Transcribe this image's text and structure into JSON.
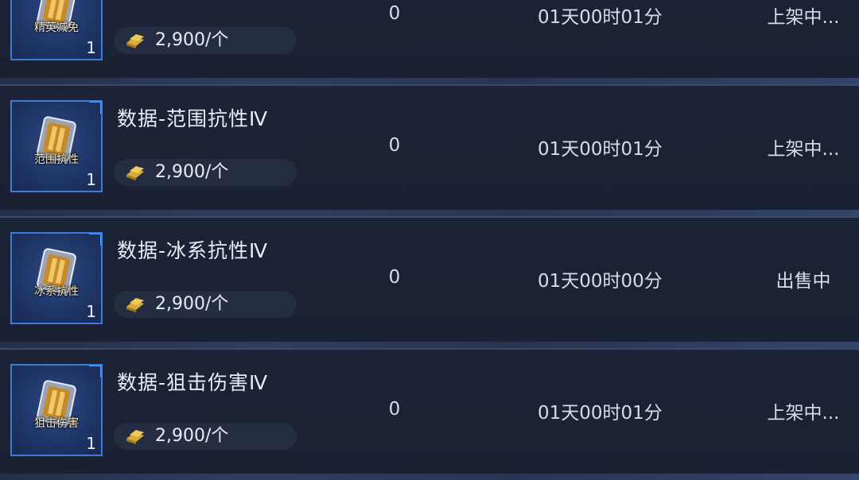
{
  "listings": [
    {
      "name": "",
      "item_label": "精英减免",
      "quantity": "1",
      "price": "2,900/个",
      "count": "0",
      "time_left": "01天00时01分",
      "status": "上架中..."
    },
    {
      "name": "数据-范围抗性Ⅳ",
      "item_label": "范围抗性",
      "quantity": "1",
      "price": "2,900/个",
      "count": "0",
      "time_left": "01天00时01分",
      "status": "上架中..."
    },
    {
      "name": "数据-冰系抗性Ⅳ",
      "item_label": "冰系抗性",
      "quantity": "1",
      "price": "2,900/个",
      "count": "0",
      "time_left": "01天00时00分",
      "status": "出售中"
    },
    {
      "name": "数据-狙击伤害Ⅳ",
      "item_label": "狙击伤害",
      "quantity": "1",
      "price": "2,900/个",
      "count": "0",
      "time_left": "01天00时01分",
      "status": "上架中..."
    }
  ],
  "icons": {
    "item": "data-chip-icon",
    "currency": "gold-bar-icon"
  },
  "colors": {
    "accent_border": "#3f7ad8",
    "text": "#e8ecf5",
    "currency_gold": "#d9a93a"
  }
}
